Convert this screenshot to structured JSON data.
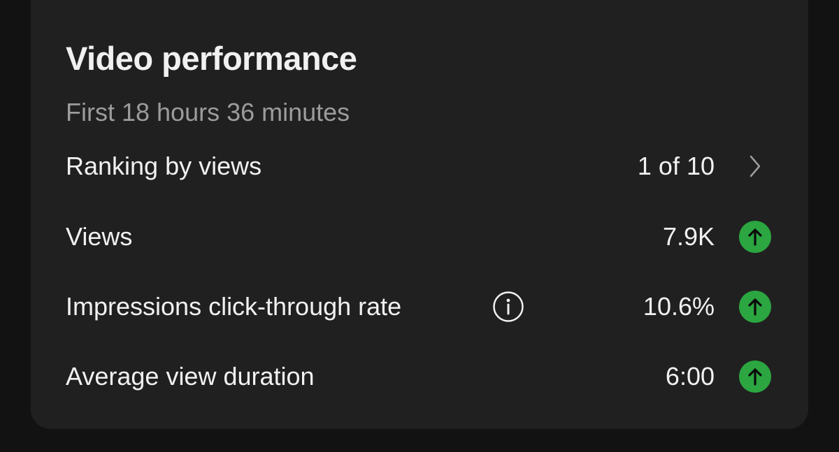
{
  "card": {
    "title": "Video performance",
    "subtitle": "First 18 hours 36 minutes"
  },
  "rows": [
    {
      "label": "Ranking by views",
      "value": "1 of 10",
      "trailing_icon": "chevron-right-icon"
    },
    {
      "label": "Views",
      "value": "7.9K",
      "trailing_icon": "arrow-up-icon",
      "trend": "up"
    },
    {
      "label": "Impressions click-through rate",
      "value": "10.6%",
      "info_icon": "info-icon",
      "trailing_icon": "arrow-up-icon",
      "trend": "up"
    },
    {
      "label": "Average view duration",
      "value": "6:00",
      "trailing_icon": "arrow-up-icon",
      "trend": "up"
    }
  ],
  "colors": {
    "background": "#121212",
    "card": "#202020",
    "text": "#f1f1f1",
    "muted_text": "#9c9c9c",
    "trend_up": "#2ba640"
  }
}
